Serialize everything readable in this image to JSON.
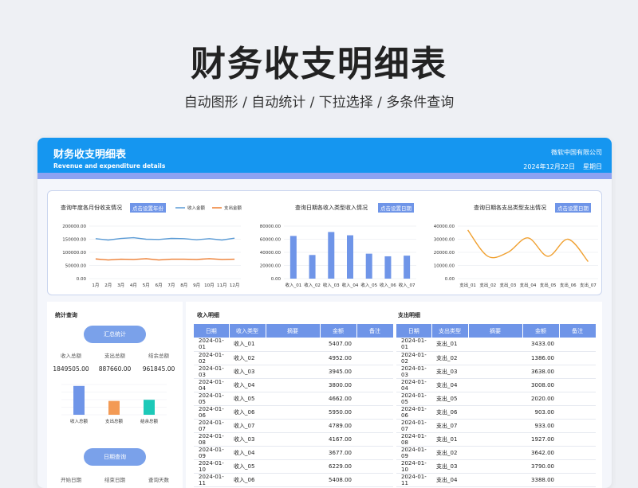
{
  "headline": "财务收支明细表",
  "subline": "自动图形  /  自动统计  /  下拉选择    /  多条件查询",
  "sheet": {
    "title": "财务收支明细表",
    "subtitle": "Revenue and expenditure details",
    "company": "微软中国有限公司",
    "date": "2024年12月22日",
    "weekday": "星期日"
  },
  "charts": {
    "monthly": {
      "title": "查询年度各月份收支情况",
      "button": "点击设置年份",
      "legend_income": "收入金额",
      "legend_expense": "支出金额"
    },
    "income_type": {
      "title": "查询日期各收入类型收入情况",
      "button": "点击设置日期"
    },
    "expense_type": {
      "title": "查询日期各支出类型支出情况",
      "button": "点击设置日期"
    }
  },
  "chart_data": [
    {
      "type": "line",
      "categories": [
        "1月",
        "2月",
        "3月",
        "4月",
        "5月",
        "6月",
        "7月",
        "8月",
        "9月",
        "10月",
        "11月",
        "12月"
      ],
      "yticks": [
        "200000.00",
        "150000.00",
        "100000.00",
        "50000.00",
        "0.00"
      ],
      "ylim": [
        0,
        200000
      ],
      "series": [
        {
          "name": "收入金额",
          "color": "#5b9bd5",
          "values": [
            152000,
            147000,
            153000,
            156000,
            150000,
            149000,
            153000,
            152000,
            148000,
            152000,
            147000,
            154000
          ]
        },
        {
          "name": "支出金额",
          "color": "#ed7d31",
          "values": [
            75000,
            71000,
            74000,
            73000,
            76000,
            71000,
            74000,
            74000,
            73000,
            76000,
            73000,
            74000
          ]
        }
      ]
    },
    {
      "type": "bar",
      "categories": [
        "收入_01",
        "收入_02",
        "收入_03",
        "收入_04",
        "收入_05",
        "收入_06",
        "收入_07"
      ],
      "yticks": [
        "80000.00",
        "60000.00",
        "40000.00",
        "20000.00",
        "0.00"
      ],
      "ylim": [
        0,
        80000
      ],
      "values": [
        65000,
        36000,
        71000,
        66000,
        38000,
        34000,
        35000
      ],
      "color": "#6f95e8"
    },
    {
      "type": "line",
      "categories": [
        "支出_01",
        "支出_02",
        "支出_03",
        "支出_04",
        "支出_05",
        "支出_06",
        "支出_07"
      ],
      "yticks": [
        "40000.00",
        "30000.00",
        "20000.00",
        "10000.00",
        "0.00"
      ],
      "ylim": [
        0,
        40000
      ],
      "values": [
        37000,
        17000,
        20000,
        31000,
        17000,
        30000,
        13000
      ],
      "color": "#f0a030"
    }
  ],
  "stats": {
    "title": "统计查询",
    "summary_button": "汇总统计",
    "labels": [
      "收入总额",
      "支出总额",
      "结余总额"
    ],
    "values": [
      "1849505.00",
      "887660.00",
      "961845.00"
    ],
    "bar_labels": [
      "收入总额",
      "支出总额",
      "结余总额"
    ],
    "bar_values": [
      1849505,
      887660,
      961845
    ],
    "bar_colors": [
      "#6f95e8",
      "#f39a55",
      "#1cc9b8"
    ],
    "date_button": "日期查询",
    "date_labels": [
      "开始日期",
      "结束日期",
      "查询天数"
    ]
  },
  "income": {
    "title": "收入明细",
    "headers": [
      "日期",
      "收入类型",
      "摘要",
      "金额",
      "备注"
    ],
    "rows": [
      [
        "2024-01-01",
        "收入_01",
        "",
        "5407.00",
        ""
      ],
      [
        "2024-01-02",
        "收入_02",
        "",
        "4952.00",
        ""
      ],
      [
        "2024-01-03",
        "收入_03",
        "",
        "3945.00",
        ""
      ],
      [
        "2024-01-04",
        "收入_04",
        "",
        "3800.00",
        ""
      ],
      [
        "2024-01-05",
        "收入_05",
        "",
        "4662.00",
        ""
      ],
      [
        "2024-01-06",
        "收入_06",
        "",
        "5950.00",
        ""
      ],
      [
        "2024-01-07",
        "收入_07",
        "",
        "4789.00",
        ""
      ],
      [
        "2024-01-08",
        "收入_03",
        "",
        "4167.00",
        ""
      ],
      [
        "2024-01-09",
        "收入_04",
        "",
        "3677.00",
        ""
      ],
      [
        "2024-01-10",
        "收入_05",
        "",
        "6229.00",
        ""
      ],
      [
        "2024-01-11",
        "收入_06",
        "",
        "5408.00",
        ""
      ]
    ]
  },
  "expense": {
    "title": "支出明细",
    "headers": [
      "日期",
      "支出类型",
      "摘要",
      "金额",
      "备注"
    ],
    "rows": [
      [
        "2024-01-01",
        "支出_01",
        "",
        "3433.00",
        ""
      ],
      [
        "2024-01-02",
        "支出_02",
        "",
        "1386.00",
        ""
      ],
      [
        "2024-01-03",
        "支出_03",
        "",
        "3638.00",
        ""
      ],
      [
        "2024-01-04",
        "支出_04",
        "",
        "3008.00",
        ""
      ],
      [
        "2024-01-05",
        "支出_05",
        "",
        "2020.00",
        ""
      ],
      [
        "2024-01-06",
        "支出_06",
        "",
        "903.00",
        ""
      ],
      [
        "2024-01-07",
        "支出_07",
        "",
        "933.00",
        ""
      ],
      [
        "2024-01-08",
        "支出_01",
        "",
        "1927.00",
        ""
      ],
      [
        "2024-01-09",
        "支出_02",
        "",
        "3642.00",
        ""
      ],
      [
        "2024-01-10",
        "支出_03",
        "",
        "3790.00",
        ""
      ],
      [
        "2024-01-11",
        "支出_04",
        "",
        "3388.00",
        ""
      ]
    ]
  }
}
